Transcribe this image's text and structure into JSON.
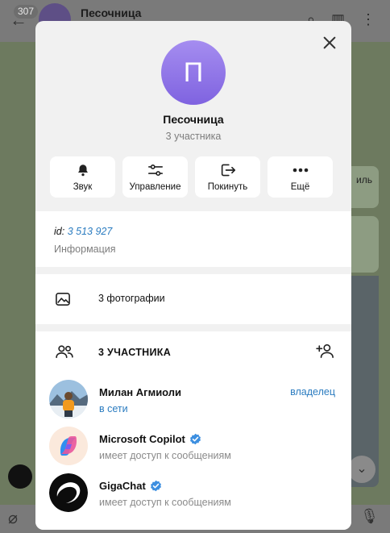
{
  "background": {
    "unread_badge": "307",
    "chat_title": "Песочница",
    "bubble_snippet": "иль"
  },
  "modal": {
    "avatar_letter": "П",
    "group_name": "Песочница",
    "member_count_text": "3 участника",
    "actions": [
      {
        "label": "Звук",
        "icon": "bell-icon"
      },
      {
        "label": "Управление",
        "icon": "sliders-icon"
      },
      {
        "label": "Покинуть",
        "icon": "leave-icon"
      },
      {
        "label": "Ещё",
        "icon": "more-icon"
      }
    ],
    "info": {
      "id_prefix": "id:",
      "id_value": "3 513 927",
      "label": "Информация"
    },
    "photos": {
      "label": "3 фотографии",
      "icon": "image-icon"
    },
    "members": {
      "title": "3 УЧАСТНИКА",
      "list": [
        {
          "name": "Милан Агмиоли",
          "status": "в сети",
          "role": "владелец",
          "verified": false
        },
        {
          "name": "Microsoft Copilot",
          "status": "имеет доступ к сообщениям",
          "role": "",
          "verified": true
        },
        {
          "name": "GigaChat",
          "status": "имеет доступ к сообщениям",
          "role": "",
          "verified": true
        }
      ]
    }
  },
  "colors": {
    "accent": "#2b7cc0",
    "avatar_gradient_top": "#a58df0",
    "avatar_gradient_bottom": "#7f63e0",
    "verified": "#3d8fe0"
  }
}
